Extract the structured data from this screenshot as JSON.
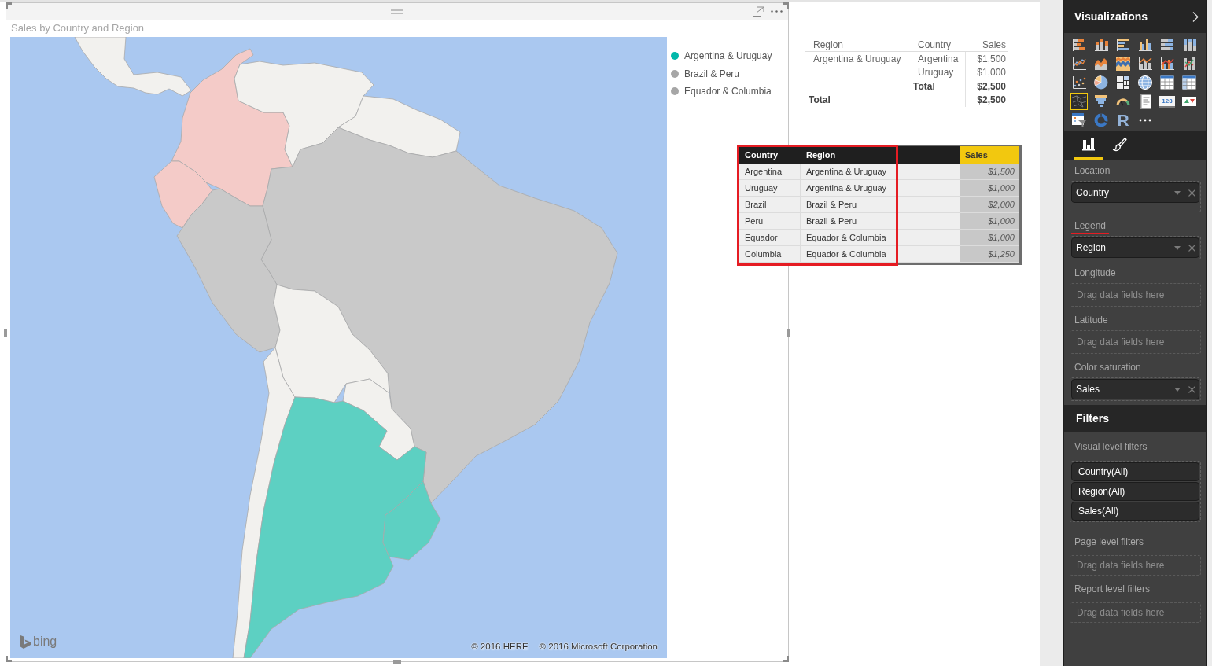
{
  "map_visual": {
    "title": "Sales by Country and Region",
    "legend": [
      {
        "label": "Argentina & Uruguay",
        "color": "#01b8aa"
      },
      {
        "label": "Brazil & Peru",
        "color": "#a6a6a6"
      },
      {
        "label": "Equador & Columbia",
        "color": "#a6a6a6"
      }
    ],
    "logo": "bing",
    "attribution": [
      "© 2016 HERE",
      "© 2016 Microsoft Corporation"
    ]
  },
  "matrix": {
    "columns": [
      "Region",
      "Country",
      "Sales"
    ],
    "rows": [
      {
        "kind": "row",
        "region": "Argentina & Uruguay",
        "country": "Argentina",
        "sales": "$1,500"
      },
      {
        "kind": "row",
        "country": "Uruguay",
        "sales": "$1,000"
      },
      {
        "kind": "subtotal",
        "country": "Total",
        "sales": "$2,500"
      },
      {
        "kind": "total",
        "region": "Total",
        "sales": "$2,500"
      }
    ]
  },
  "data_table": {
    "columns": [
      {
        "label": "Country",
        "highlighted": false,
        "outlined": true
      },
      {
        "label": "Region",
        "highlighted": false,
        "outlined": true
      },
      {
        "label": "Sales",
        "highlighted": true,
        "outlined": false
      }
    ],
    "rows": [
      [
        "Argentina",
        "Argentina & Uruguay",
        "$1,500"
      ],
      [
        "Uruguay",
        "Argentina & Uruguay",
        "$1,000"
      ],
      [
        "Brazil",
        "Brazil & Peru",
        "$2,000"
      ],
      [
        "Peru",
        "Brazil & Peru",
        "$1,000"
      ],
      [
        "Equador",
        "Equador & Columbia",
        "$1,000"
      ],
      [
        "Columbia",
        "Equador & Columbia",
        "$1,250"
      ]
    ]
  },
  "visualizations": {
    "title": "Visualizations",
    "types": [
      {
        "kind": "stacked-bar",
        "selected": false
      },
      {
        "kind": "stacked-column",
        "selected": false
      },
      {
        "kind": "clustered-bar",
        "selected": false
      },
      {
        "kind": "clustered-column",
        "selected": false
      },
      {
        "kind": "full-bar",
        "selected": false
      },
      {
        "kind": "full-column",
        "selected": false
      },
      {
        "kind": "line",
        "selected": false
      },
      {
        "kind": "area",
        "selected": false
      },
      {
        "kind": "stacked-area",
        "selected": false
      },
      {
        "kind": "line-column",
        "selected": false
      },
      {
        "kind": "line-clustered",
        "selected": false
      },
      {
        "kind": "ribbon",
        "selected": false
      },
      {
        "kind": "scatter",
        "selected": false
      },
      {
        "kind": "pie",
        "selected": false
      },
      {
        "kind": "treemap",
        "selected": false
      },
      {
        "kind": "globe",
        "selected": false
      },
      {
        "kind": "table",
        "selected": false
      },
      {
        "kind": "matrix",
        "selected": false
      },
      {
        "kind": "filled-map",
        "selected": true
      },
      {
        "kind": "funnel",
        "selected": false
      },
      {
        "kind": "gauge",
        "selected": false
      },
      {
        "kind": "list",
        "selected": false
      },
      {
        "kind": "card",
        "label": "123",
        "selected": false
      },
      {
        "kind": "kpi",
        "selected": false
      },
      {
        "kind": "table-filter",
        "selected": false
      },
      {
        "kind": "donut",
        "selected": false
      },
      {
        "kind": "r-script",
        "label": "R",
        "selected": false
      },
      {
        "kind": "more",
        "selected": false
      }
    ],
    "tabs": [
      {
        "kind": "fields",
        "selected": true
      },
      {
        "kind": "format",
        "selected": false
      }
    ],
    "wells": [
      {
        "label": "Location",
        "underlined": false,
        "fields": [
          "Country"
        ]
      },
      {
        "label": "Legend",
        "underlined": true,
        "fields": [
          "Region"
        ]
      },
      {
        "label": "Longitude",
        "underlined": false,
        "placeholder": "Drag data fields here"
      },
      {
        "label": "Latitude",
        "underlined": false,
        "placeholder": "Drag data fields here"
      },
      {
        "label": "Color saturation",
        "underlined": false,
        "fields": [
          "Sales"
        ]
      }
    ]
  },
  "filters": {
    "title": "Filters",
    "sections": [
      {
        "label": "Visual level filters",
        "fields": [
          "Country(All)",
          "Region(All)",
          "Sales(All)"
        ]
      },
      {
        "label": "Page level filters",
        "placeholder": "Drag data fields here"
      },
      {
        "label": "Report level filters",
        "placeholder": "Drag data fields here"
      }
    ]
  }
}
